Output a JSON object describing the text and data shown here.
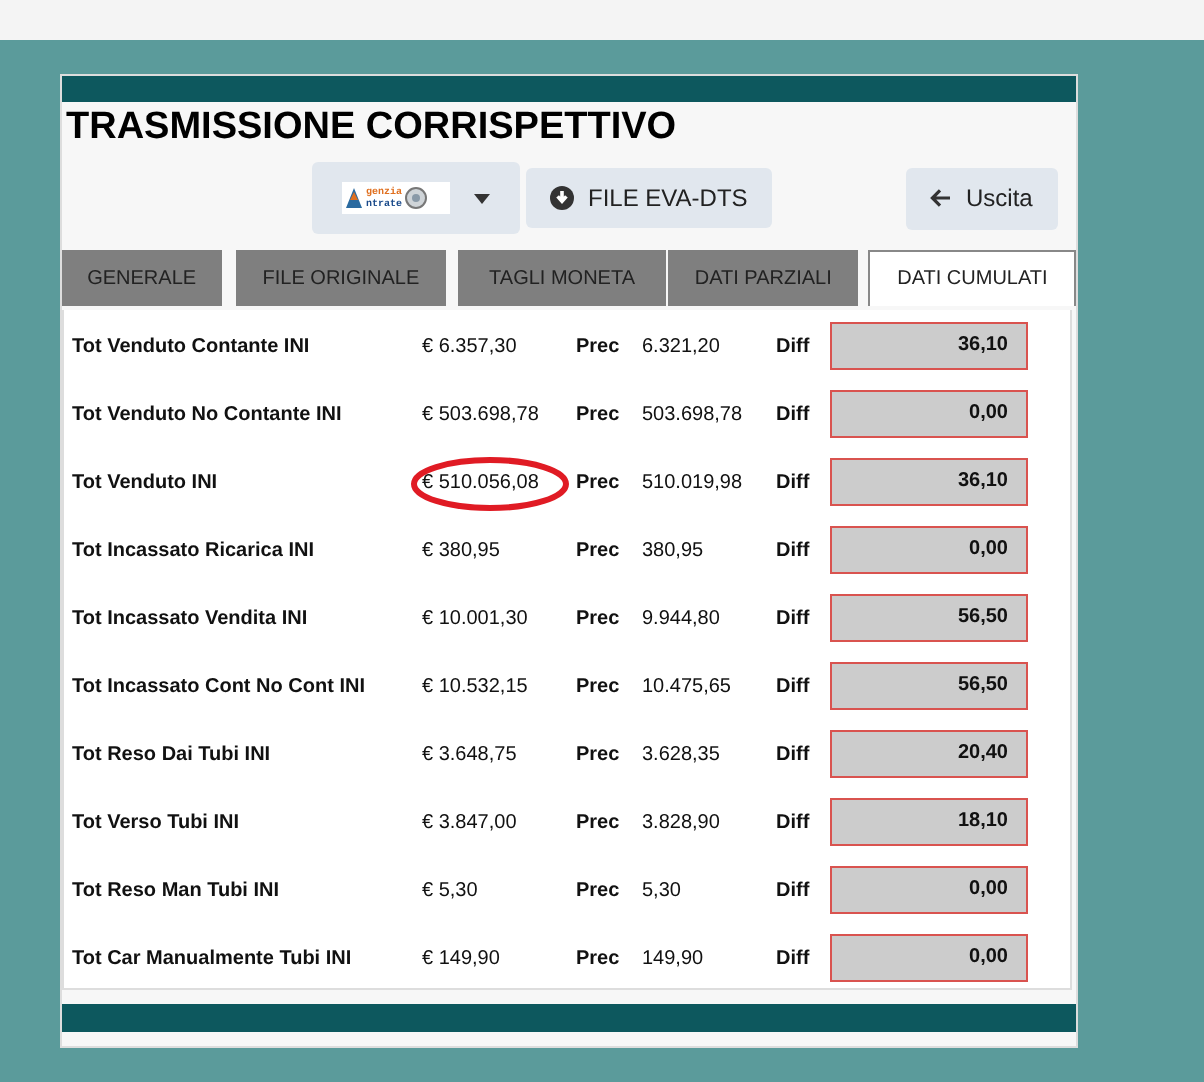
{
  "title": "TRASMISSIONE CORRISPETTIVO",
  "toolbar": {
    "logo": {
      "line_1": "genzia",
      "line_2": "ntrate"
    },
    "file_button": "FILE EVA-DTS",
    "exit_button": "Uscita"
  },
  "tabs": [
    {
      "label": "GENERALE",
      "selected": false
    },
    {
      "label": "FILE ORIGINALE",
      "selected": false
    },
    {
      "label": "TAGLI MONETA",
      "selected": false
    },
    {
      "label": "DATI PARZIALI",
      "selected": false
    },
    {
      "label": "DATI CUMULATI",
      "selected": true
    }
  ],
  "rows": [
    {
      "label": "Tot Venduto Contante INI",
      "value": "€ 6.357,30",
      "prec_label": "Prec",
      "prec": "6.321,20",
      "diff_label": "Diff",
      "diff": "36,10",
      "circled": false
    },
    {
      "label": "Tot Venduto No Contante INI",
      "value": "€ 503.698,78",
      "prec_label": "Prec",
      "prec": "503.698,78",
      "diff_label": "Diff",
      "diff": "0,00",
      "circled": false
    },
    {
      "label": "Tot Venduto INI",
      "value": "€ 510.056,08",
      "prec_label": "Prec",
      "prec": "510.019,98",
      "diff_label": "Diff",
      "diff": "36,10",
      "circled": true
    },
    {
      "label": "Tot Incassato Ricarica INI",
      "value": "€ 380,95",
      "prec_label": "Prec",
      "prec": "380,95",
      "diff_label": "Diff",
      "diff": "0,00",
      "circled": false
    },
    {
      "label": "Tot Incassato Vendita INI",
      "value": "€ 10.001,30",
      "prec_label": "Prec",
      "prec": "9.944,80",
      "diff_label": "Diff",
      "diff": "56,50",
      "circled": false
    },
    {
      "label": "Tot Incassato Cont No Cont INI",
      "value": "€ 10.532,15",
      "prec_label": "Prec",
      "prec": "10.475,65",
      "diff_label": "Diff",
      "diff": "56,50",
      "circled": false
    },
    {
      "label": "Tot Reso Dai Tubi INI",
      "value": "€ 3.648,75",
      "prec_label": "Prec",
      "prec": "3.628,35",
      "diff_label": "Diff",
      "diff": "20,40",
      "circled": false
    },
    {
      "label": "Tot Verso Tubi INI",
      "value": "€ 3.847,00",
      "prec_label": "Prec",
      "prec": "3.828,90",
      "diff_label": "Diff",
      "diff": "18,10",
      "circled": false
    },
    {
      "label": "Tot Reso Man Tubi INI",
      "value": "€ 5,30",
      "prec_label": "Prec",
      "prec": "5,30",
      "diff_label": "Diff",
      "diff": "0,00",
      "circled": false
    },
    {
      "label": "Tot Car Manualmente Tubi INI",
      "value": "€ 149,90",
      "prec_label": "Prec",
      "prec": "149,90",
      "diff_label": "Diff",
      "diff": "0,00",
      "circled": false
    }
  ]
}
